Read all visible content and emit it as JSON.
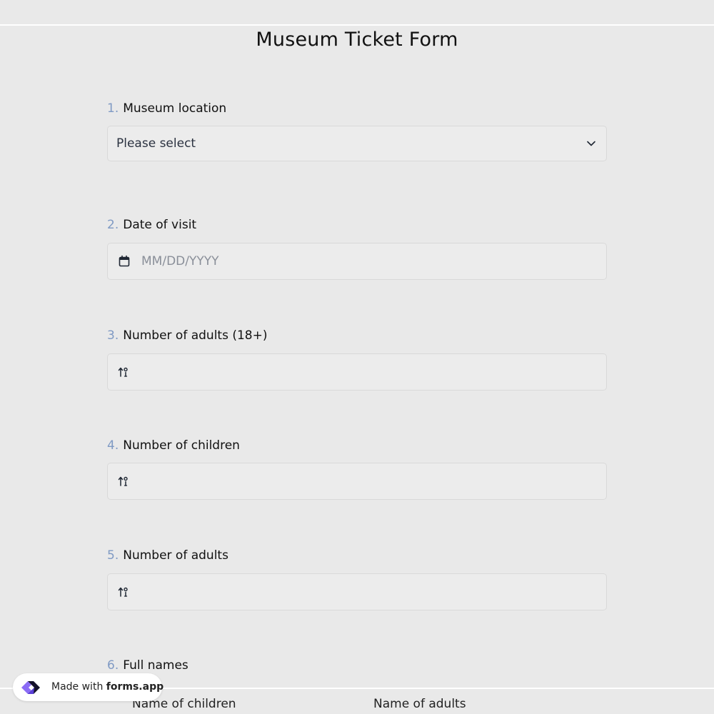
{
  "form": {
    "title": "Museum Ticket Form"
  },
  "questions": [
    {
      "number": "1.",
      "label": "Museum location",
      "type": "select",
      "value": "Please select"
    },
    {
      "number": "2.",
      "label": "Date of visit",
      "type": "date",
      "placeholder": "MM/DD/YYYY"
    },
    {
      "number": "3.",
      "label": "Number of adults (18+)",
      "type": "number",
      "value": ""
    },
    {
      "number": "4.",
      "label": "Number of children",
      "type": "number",
      "value": ""
    },
    {
      "number": "5.",
      "label": "Number of adults",
      "type": "number",
      "value": ""
    },
    {
      "number": "6.",
      "label": "Full names",
      "type": "columns",
      "columns": [
        "Name of children",
        "Name of adults"
      ]
    }
  ],
  "badge": {
    "prefix": "Made with",
    "brand": "forms.app"
  },
  "colors": {
    "background": "#e9e9e9",
    "question_number": "#7f9ac4",
    "field_background": "#ececec",
    "field_border": "#d9d9d9"
  },
  "icons": {
    "select": "chevron-down-icon",
    "date": "calendar-icon",
    "number": "number-sort-icon",
    "badge": "forms-app-logo"
  }
}
